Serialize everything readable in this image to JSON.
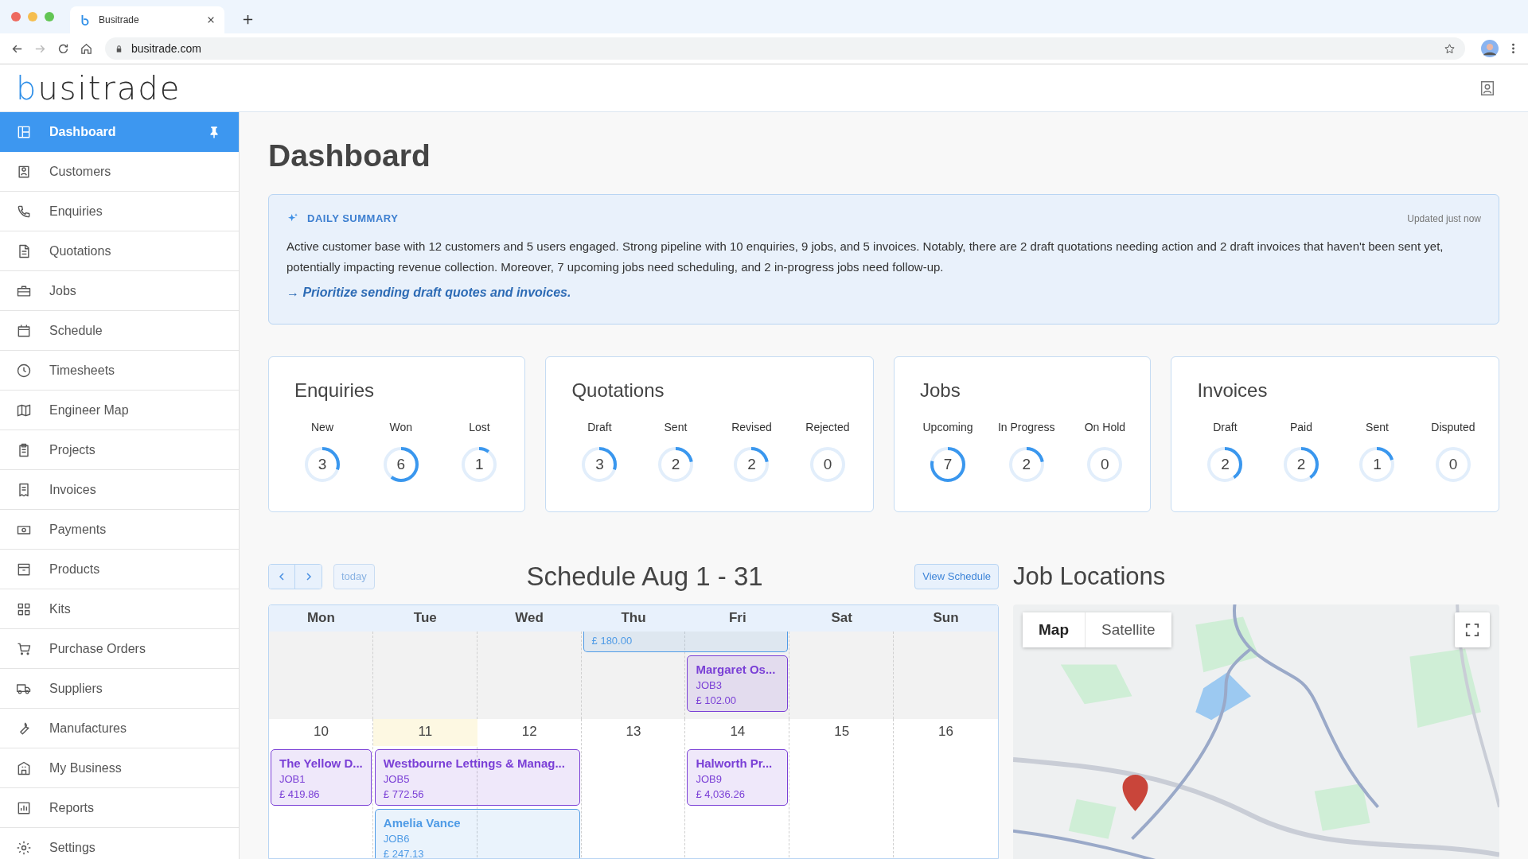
{
  "browser": {
    "tab_title": "Busitrade",
    "url": "busitrade.com"
  },
  "logo": {
    "mark": "b",
    "rest": "usitrade"
  },
  "sidebar": {
    "items": [
      {
        "label": "Dashboard",
        "selected": true
      },
      {
        "label": "Customers",
        "selected": false
      },
      {
        "label": "Enquiries",
        "selected": false
      },
      {
        "label": "Quotations",
        "selected": false
      },
      {
        "label": "Jobs",
        "selected": false
      },
      {
        "label": "Schedule",
        "selected": false
      },
      {
        "label": "Timesheets",
        "selected": false
      },
      {
        "label": "Engineer Map",
        "selected": false
      },
      {
        "label": "Projects",
        "selected": false
      },
      {
        "label": "Invoices",
        "selected": false
      },
      {
        "label": "Payments",
        "selected": false
      },
      {
        "label": "Products",
        "selected": false
      },
      {
        "label": "Kits",
        "selected": false
      },
      {
        "label": "Purchase Orders",
        "selected": false
      },
      {
        "label": "Suppliers",
        "selected": false
      },
      {
        "label": "Manufactures",
        "selected": false
      },
      {
        "label": "My Business",
        "selected": false
      },
      {
        "label": "Reports",
        "selected": false
      },
      {
        "label": "Settings",
        "selected": false
      }
    ]
  },
  "page_title": "Dashboard",
  "summary": {
    "title": "DAILY SUMMARY",
    "updated": "Updated just now",
    "text": "Active customer base with 12 customers and 5 users engaged. Strong pipeline with 10 enquiries, 9 jobs, and 5 invoices. Notably, there are 2 draft quotations needing action and 2 draft invoices that haven't been sent yet, potentially impacting revenue collection. Moreover, 7 upcoming jobs need scheduling, and 2 in-progress jobs need follow-up.",
    "action": "→ Prioritize sending draft quotes and invoices."
  },
  "stat_cards": [
    {
      "title": "Enquiries",
      "stats": [
        {
          "label": "New",
          "value": "3",
          "level": 0.3
        },
        {
          "label": "Won",
          "value": "6",
          "level": 0.6
        },
        {
          "label": "Lost",
          "value": "1",
          "level": 0.1
        }
      ]
    },
    {
      "title": "Quotations",
      "stats": [
        {
          "label": "Draft",
          "value": "3",
          "level": 0.3
        },
        {
          "label": "Sent",
          "value": "2",
          "level": 0.22
        },
        {
          "label": "Revised",
          "value": "2",
          "level": 0.22
        },
        {
          "label": "Rejected",
          "value": "0",
          "level": 0
        }
      ]
    },
    {
      "title": "Jobs",
      "stats": [
        {
          "label": "Upcoming",
          "value": "7",
          "level": 0.78
        },
        {
          "label": "In Progress",
          "value": "2",
          "level": 0.22
        },
        {
          "label": "On Hold",
          "value": "0",
          "level": 0
        }
      ]
    },
    {
      "title": "Invoices",
      "stats": [
        {
          "label": "Draft",
          "value": "2",
          "level": 0.4
        },
        {
          "label": "Paid",
          "value": "2",
          "level": 0.4
        },
        {
          "label": "Sent",
          "value": "1",
          "level": 0.2
        },
        {
          "label": "Disputed",
          "value": "0",
          "level": 0
        }
      ]
    }
  ],
  "schedule": {
    "title": "Schedule Aug 1 - 31",
    "today_button": "today",
    "view_button": "View Schedule",
    "weekdays": [
      "Mon",
      "Tue",
      "Wed",
      "Thu",
      "Fri",
      "Sat",
      "Sun"
    ],
    "weeks": [
      {
        "shaded": true,
        "events": [
          {
            "amount": "£ 180.00",
            "color": "#4f9be6"
          },
          {
            "title": "Margaret Os...",
            "job": "JOB3",
            "amount": "£ 102.00",
            "color": "#7a3fd6"
          }
        ]
      },
      {
        "shaded": false,
        "days": [
          {
            "date": "10",
            "today": false
          },
          {
            "date": "11",
            "today": true
          },
          {
            "date": "12",
            "today": false
          },
          {
            "date": "13",
            "today": false
          },
          {
            "date": "14",
            "today": false
          },
          {
            "date": "15",
            "today": false
          },
          {
            "date": "16",
            "today": false
          }
        ],
        "events": [
          {
            "title": "The Yellow D...",
            "job": "JOB1",
            "amount": "£ 419.86",
            "color": "#7a3fd6"
          },
          {
            "title": "Westbourne Lettings & Manag...",
            "job": "JOB5",
            "amount": "£ 772.56",
            "color": "#7a3fd6"
          },
          {
            "title": "Halworth Pr...",
            "job": "JOB9",
            "amount": "£ 4,036.26",
            "color": "#7a3fd6"
          },
          {
            "title": "Amelia Vance",
            "job": "JOB6",
            "amount": "£ 247.13",
            "color": "#4f9be6"
          }
        ]
      }
    ]
  },
  "map": {
    "title": "Job Locations",
    "map_types": [
      {
        "label": "Map",
        "selected": true
      },
      {
        "label": "Satellite",
        "selected": false
      }
    ]
  }
}
